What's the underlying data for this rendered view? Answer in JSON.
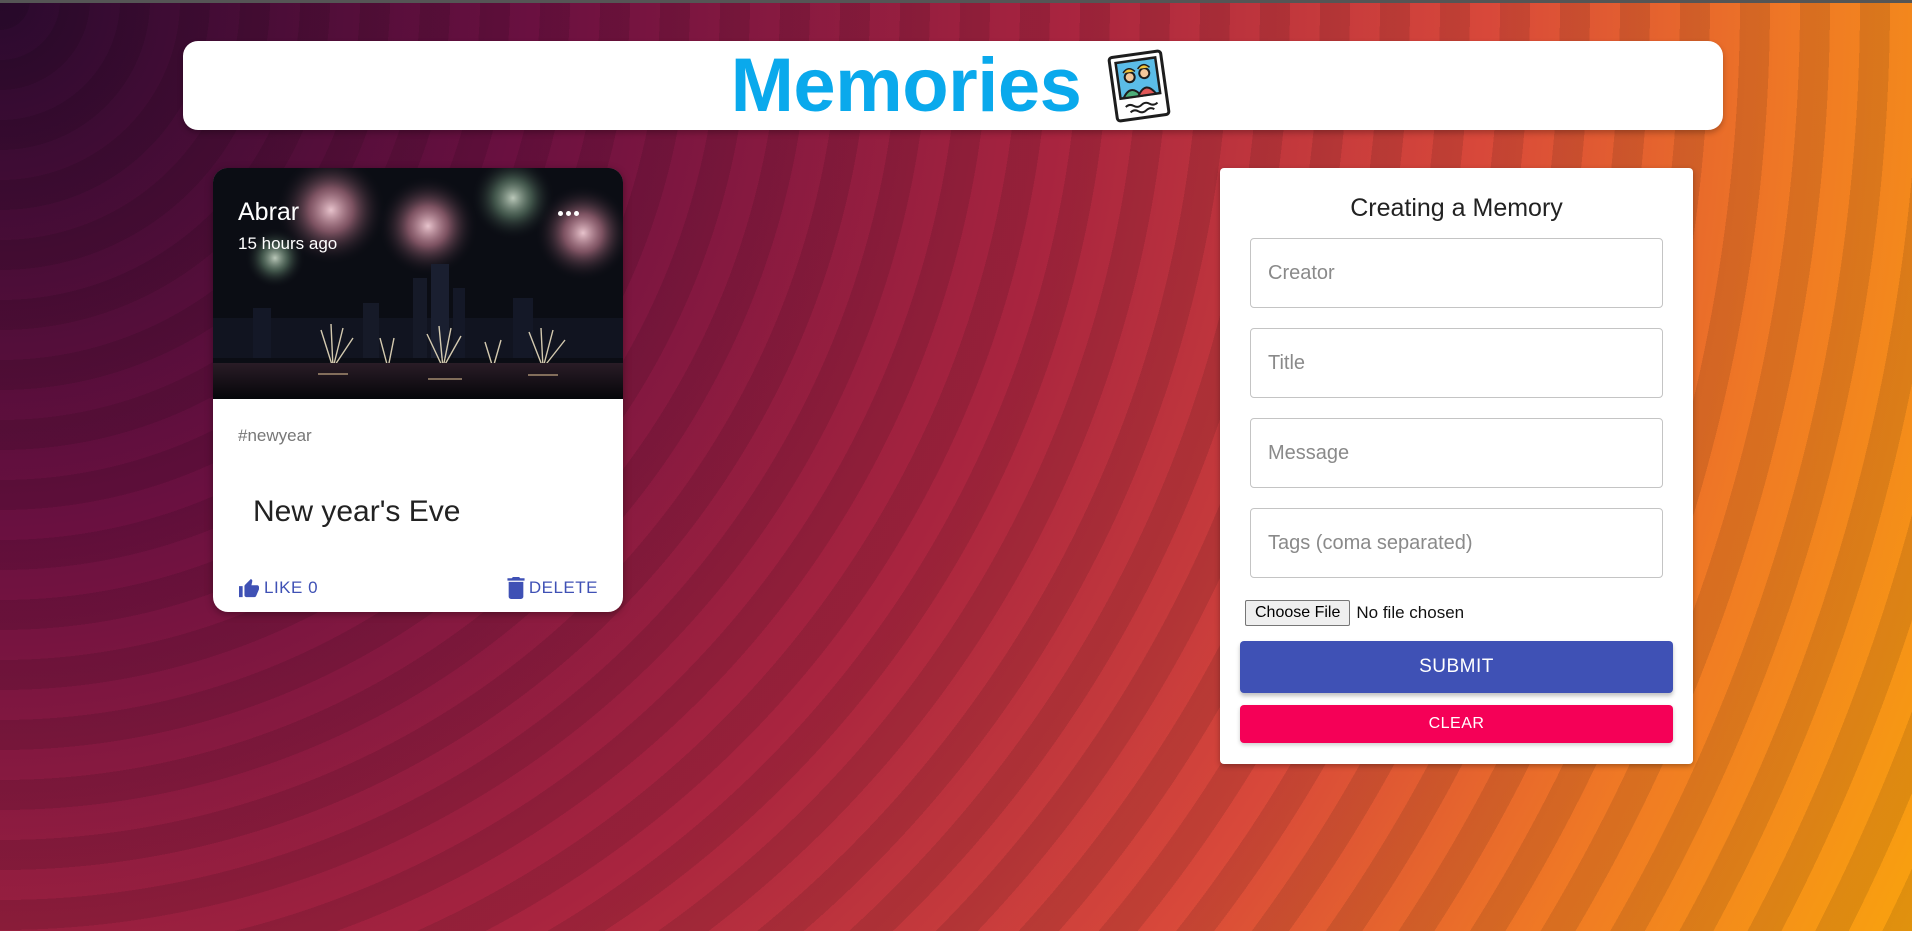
{
  "app": {
    "title": "Memories",
    "logo_icon": "polaroid-photo-icon",
    "accent_color": "#0aa9ec"
  },
  "posts": [
    {
      "creator": "Abrar",
      "time_ago": "15 hours ago",
      "tags": "#newyear",
      "title": "New year's Eve",
      "like_label": "LIKE 0",
      "delete_label": "DELETE",
      "image_subject": "fireworks-over-city-skyline"
    }
  ],
  "form": {
    "title": "Creating a Memory",
    "creator_placeholder": "Creator",
    "title_placeholder": "Title",
    "message_placeholder": "Message",
    "tags_placeholder": "Tags (coma separated)",
    "file_button": "Choose File",
    "file_status": "No file chosen",
    "submit_label": "SUBMIT",
    "clear_label": "CLEAR",
    "submit_color": "#3f51b5",
    "clear_color": "#f50057"
  }
}
